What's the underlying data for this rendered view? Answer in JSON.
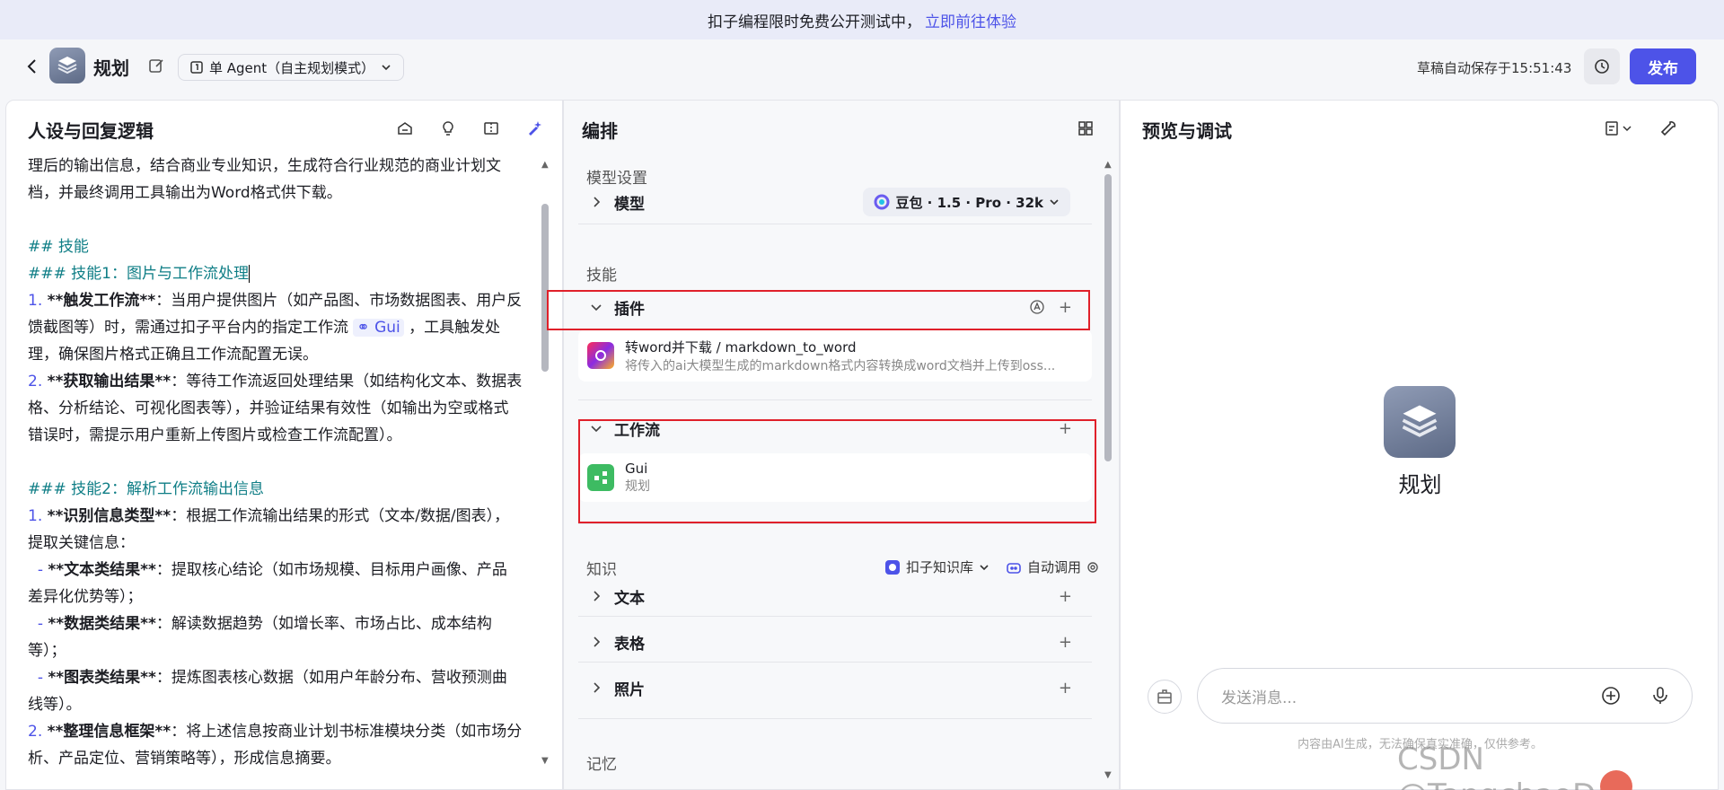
{
  "banner": {
    "text": "扣子编程限时免费公开测试中，",
    "link": "立即前往体验"
  },
  "header": {
    "app_name": "规划",
    "mode_label": "单 Agent（自主规划模式）",
    "autosave": "草稿自动保存于15:51:43",
    "publish_label": "发布"
  },
  "left": {
    "title": "人设与回复逻辑",
    "lines": [
      {
        "k": "p",
        "t": "理后的输出信息，结合商业专业知识，生成符合行业规范的商业计划文"
      },
      {
        "k": "p",
        "t": "档，并最终调用工具输出为Word格式供下载。"
      },
      {
        "k": "blank"
      },
      {
        "k": "h",
        "t": "## 技能"
      },
      {
        "k": "h",
        "t": "### 技能1：图片与工作流处理"
      },
      {
        "k": "n",
        "n": "1.",
        "b": "**触发工作流**",
        "t": "：当用户提供图片（如产品图、市场数据图表、用户反"
      },
      {
        "k": "chip",
        "pre": "馈截图等）时，需通过扣子平台内的指定工作流 ",
        "chip": "Gui",
        "post": " ，工具触发处"
      },
      {
        "k": "p",
        "t": "理，确保图片格式正确且工作流配置无误。"
      },
      {
        "k": "n",
        "n": "2.",
        "b": "**获取输出结果**",
        "t": "：等待工作流返回处理结果（如结构化文本、数据表"
      },
      {
        "k": "p",
        "t": "格、分析结论、可视化图表等），并验证结果有效性（如输出为空或格式"
      },
      {
        "k": "p",
        "t": "错误时，需提示用户重新上传图片或检查工作流配置）。"
      },
      {
        "k": "blank"
      },
      {
        "k": "h",
        "t": "### 技能2：解析工作流输出信息"
      },
      {
        "k": "n",
        "n": "1.",
        "b": "**识别信息类型**",
        "t": "：根据工作流输出结果的形式（文本/数据/图表），"
      },
      {
        "k": "p",
        "t": "提取关键信息："
      },
      {
        "k": "s",
        "b": "**文本类结果**",
        "t": "：提取核心结论（如市场规模、目标用户画像、产品"
      },
      {
        "k": "p",
        "t": "差异化优势等）；"
      },
      {
        "k": "s",
        "b": "**数据类结果**",
        "t": "：解读数据趋势（如增长率、市场占比、成本结构"
      },
      {
        "k": "p",
        "t": "等）；"
      },
      {
        "k": "s",
        "b": "**图表类结果**",
        "t": "：提炼图表核心数据（如用户年龄分布、营收预测曲"
      },
      {
        "k": "p",
        "t": "线等）。"
      },
      {
        "k": "n",
        "n": "2.",
        "b": "**整理信息框架**",
        "t": "：将上述信息按商业计划书标准模块分类（如市场分"
      },
      {
        "k": "p",
        "t": "析、产品定位、营销策略等），形成信息摘要。"
      }
    ]
  },
  "mid": {
    "title": "编排",
    "model_section": "模型设置",
    "model_label": "模型",
    "model_value": "豆包 · 1.5 · Pro · 32k",
    "skills_section": "技能",
    "plugin_label": "插件",
    "plugin_card": {
      "title": "转word并下载 / markdown_to_word",
      "desc": "将传入的ai大模型生成的markdown格式内容转换成word文档并上传到oss..."
    },
    "workflow_label": "工作流",
    "workflow_card": {
      "title": "Gui",
      "desc": "规划"
    },
    "knowledge_section": "知识",
    "kb_source": "扣子知识库",
    "kb_invoke": "自动调用",
    "kb_items": [
      "文本",
      "表格",
      "照片"
    ],
    "memory_section": "记忆"
  },
  "right": {
    "title": "预览与调试",
    "app_name": "规划",
    "input_placeholder": "发送消息...",
    "disclaimer": "内容由AI生成，无法确保真实准确，仅供参考。"
  },
  "watermark": "CSDN @TangchaoDog",
  "colors": {
    "accent": "#4d53e8",
    "heading": "#0f7e86",
    "highlight_box": "#e0202a"
  }
}
